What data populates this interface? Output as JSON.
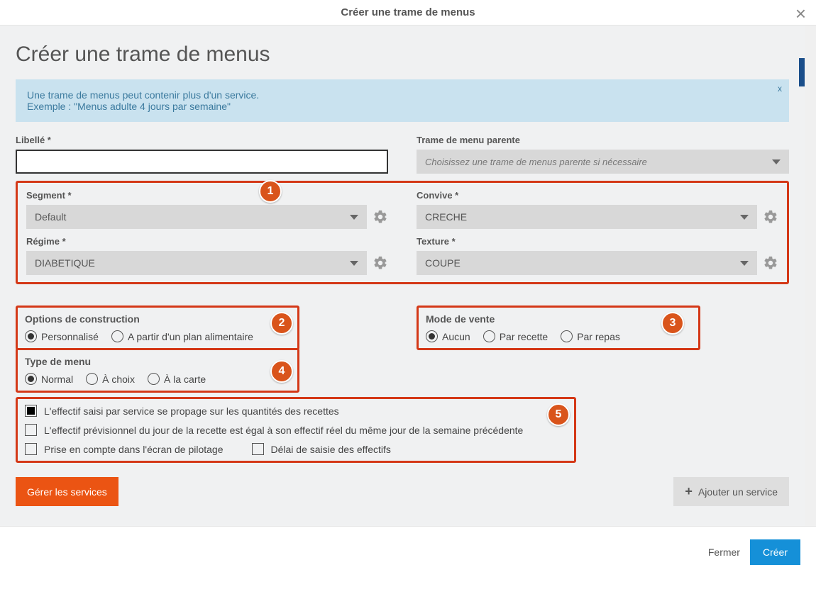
{
  "header": {
    "title": "Créer une trame de menus"
  },
  "page": {
    "title": "Créer une trame de menus"
  },
  "info": {
    "line1": "Une trame de menus peut contenir plus d'un service.",
    "line2": "Exemple : \"Menus adulte 4 jours par semaine\"",
    "dismiss": "x"
  },
  "labels": {
    "libelle": "Libellé *",
    "parent": "Trame de menu parente",
    "segment": "Segment *",
    "convive": "Convive *",
    "regime": "Régime *",
    "texture": "Texture *"
  },
  "values": {
    "parent_placeholder": "Choisissez une trame de menus parente si nécessaire",
    "segment": "Default",
    "convive": "CRECHE",
    "regime": "DIABETIQUE",
    "texture": "COUPE"
  },
  "options_construction": {
    "title": "Options de construction",
    "personnalise": "Personnalisé",
    "plan": "A partir d'un plan alimentaire"
  },
  "mode_vente": {
    "title": "Mode de vente",
    "aucun": "Aucun",
    "par_recette": "Par recette",
    "par_repas": "Par repas"
  },
  "type_menu": {
    "title": "Type de menu",
    "normal": "Normal",
    "choix": "À choix",
    "carte": "À la carte"
  },
  "checks": {
    "c1": "L'effectif saisi par service se propage sur les quantités des recettes",
    "c2": "L'effectif prévisionnel du jour de la recette est égal à son effectif réel du même jour de la semaine précédente",
    "c3": "Prise en compte dans l'écran de pilotage",
    "c4": "Délai de saisie des effectifs"
  },
  "buttons": {
    "gerer": "Gérer les services",
    "ajouter": "Ajouter un service",
    "fermer": "Fermer",
    "creer": "Créer"
  },
  "badges": {
    "b1": "1",
    "b2": "2",
    "b3": "3",
    "b4": "4",
    "b5": "5"
  }
}
